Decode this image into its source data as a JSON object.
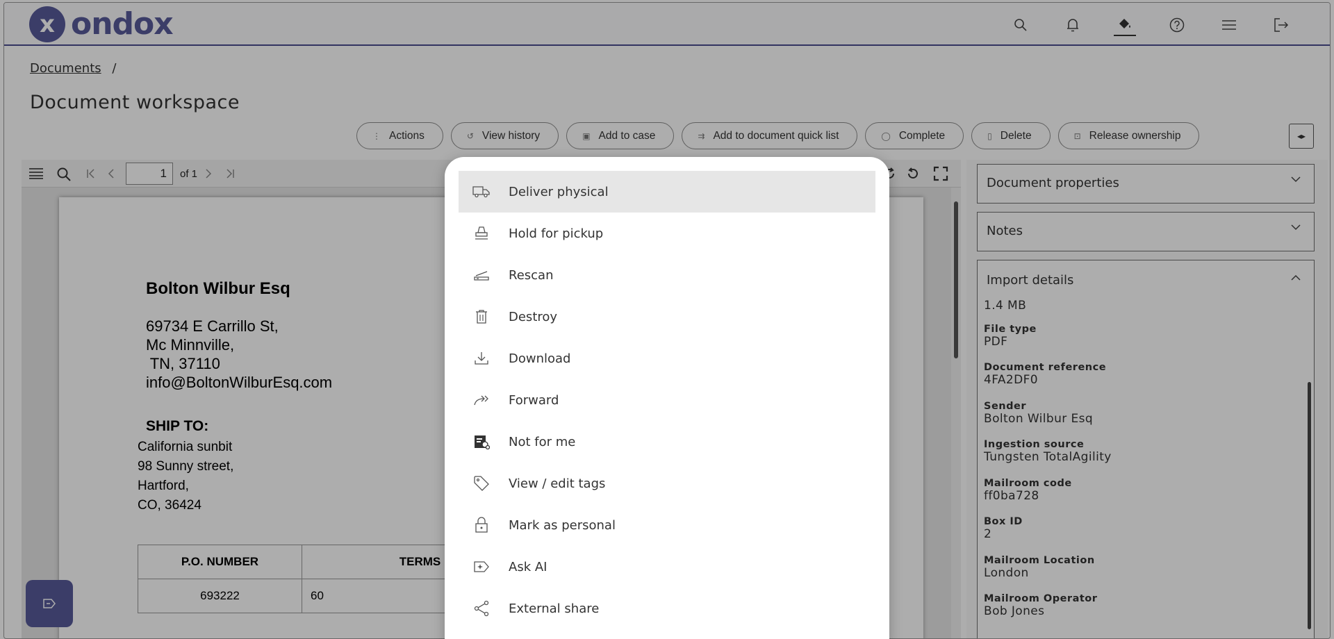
{
  "header": {
    "brand": "ondox",
    "logo_glyph": "x",
    "icons": [
      "search-icon",
      "bell-icon",
      "paint-bucket-icon",
      "help-icon",
      "menu-icon",
      "logout-icon"
    ]
  },
  "breadcrumb": {
    "link": "Documents",
    "separator": "/"
  },
  "page_title": "Document workspace",
  "toolbar": {
    "actions": "Actions",
    "view_history": "View history",
    "add_to_case": "Add to case",
    "add_to_quick_list": "Add to document quick list",
    "complete": "Complete",
    "delete": "Delete",
    "release_ownership": "Release ownership",
    "collapse_glyph": "◂▸"
  },
  "viewer": {
    "page_number": "1",
    "of_label": "of 1",
    "document": {
      "sender_name": "Bolton Wilbur Esq",
      "address": "69734 E Carrillo St,\nMc Minnville,\n TN, 37110\ninfo@BoltonWilburEsq.com",
      "ship_to_label": "SHIP TO:",
      "ship_to_lines": "California sunbit\n98 Sunny street,\nHartford,\nCO, 36424",
      "table": {
        "headers": [
          "P.O. NUMBER",
          "TERMS"
        ],
        "row": [
          "693222",
          "60"
        ]
      }
    }
  },
  "right_panel": {
    "document_properties": "Document properties",
    "notes": "Notes",
    "import_details": "Import details",
    "file_size": "1.4 MB",
    "fields": [
      {
        "label": "File type",
        "value": "PDF"
      },
      {
        "label": "Document reference",
        "value": "4FA2DF0"
      },
      {
        "label": "Sender",
        "value": "Bolton Wilbur Esq"
      },
      {
        "label": "Ingestion source",
        "value": "Tungsten TotalAgility"
      },
      {
        "label": "Mailroom code",
        "value": "ff0ba728"
      },
      {
        "label": "Box ID",
        "value": "2"
      },
      {
        "label": "Mailroom Location",
        "value": "London"
      },
      {
        "label": "Mailroom Operator",
        "value": "Bob Jones"
      }
    ]
  },
  "menu": {
    "items": [
      {
        "label": "Deliver physical",
        "icon": "truck-icon"
      },
      {
        "label": "Hold for pickup",
        "icon": "stamp-icon"
      },
      {
        "label": "Rescan",
        "icon": "scanner-icon"
      },
      {
        "label": "Destroy",
        "icon": "trash-icon"
      },
      {
        "label": "Download",
        "icon": "download-icon"
      },
      {
        "label": "Forward",
        "icon": "forward-icon"
      },
      {
        "label": "Not for me",
        "icon": "not-for-me-icon"
      },
      {
        "label": "View / edit tags",
        "icon": "tag-icon"
      },
      {
        "label": "Mark as personal",
        "icon": "lock-icon"
      },
      {
        "label": "Ask AI",
        "icon": "ai-icon"
      },
      {
        "label": "External share",
        "icon": "share-icon"
      }
    ]
  }
}
